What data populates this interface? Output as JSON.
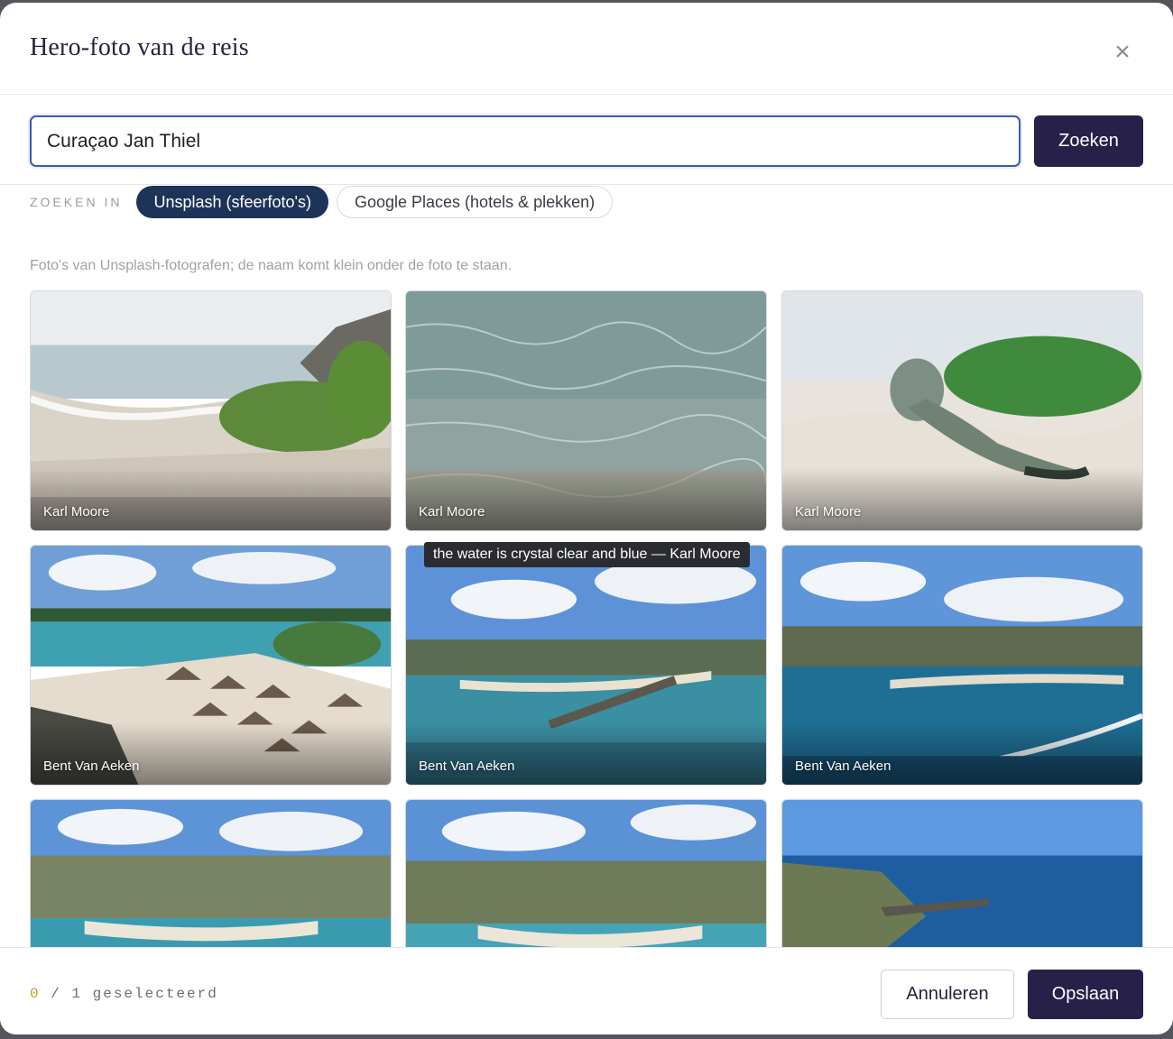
{
  "dialog": {
    "title": "Hero-foto van de reis",
    "close_icon": "close-icon"
  },
  "search": {
    "value": "Curaçao Jan Thiel",
    "button_label": "Zoeken"
  },
  "filters": {
    "label": "ZOEKEN IN",
    "options": [
      {
        "label": "Unsplash (sfeerfoto's)",
        "active": true
      },
      {
        "label": "Google Places (hotels & plekken)",
        "active": false
      }
    ]
  },
  "hint": "Foto's van Unsplash-fotografen; de naam komt klein onder de foto te staan.",
  "photos": [
    {
      "credit": "Karl Moore",
      "scene": "beach-shrub"
    },
    {
      "credit": "Karl Moore",
      "scene": "clear-water"
    },
    {
      "credit": "Karl Moore",
      "scene": "iguana"
    },
    {
      "credit": "Bent Van Aeken",
      "scene": "beach-umbrellas"
    },
    {
      "credit": "Bent Van Aeken",
      "scene": "aerial-pier"
    },
    {
      "credit": "Bent Van Aeken",
      "scene": "aerial-boat"
    },
    {
      "credit": "",
      "scene": "aerial-resort"
    },
    {
      "credit": "",
      "scene": "aerial-beach"
    },
    {
      "credit": "",
      "scene": "aerial-coast"
    }
  ],
  "tooltip": "the water is crystal clear and blue — Karl Moore",
  "footer": {
    "selected_count": "0",
    "selected_rest": " / 1 geselecteerd",
    "cancel_label": "Annuleren",
    "save_label": "Opslaan"
  },
  "colors": {
    "primary": "#27214a",
    "chip_active": "#1e3358",
    "input_border": "#3b5bb0",
    "counter_accent": "#c99a2e"
  }
}
